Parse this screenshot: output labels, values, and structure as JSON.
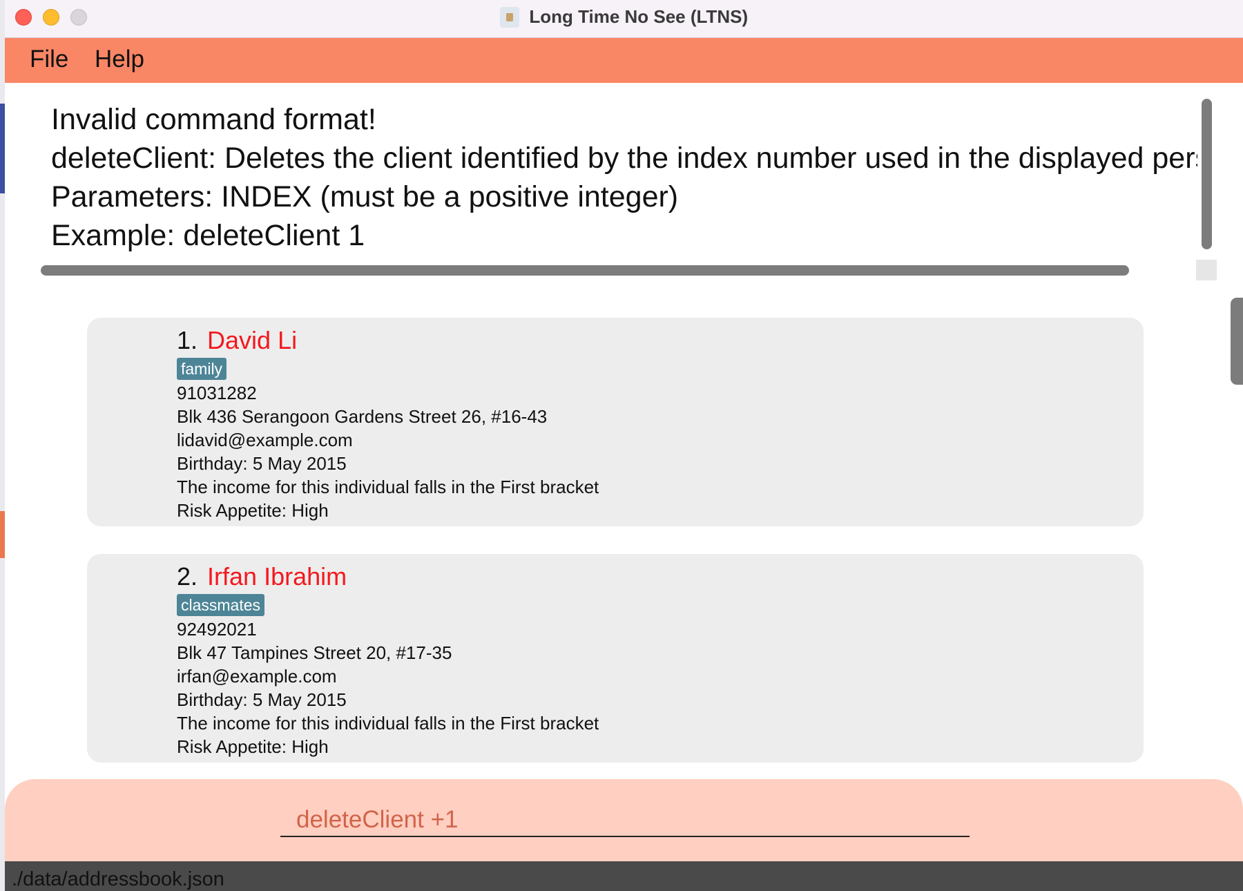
{
  "window": {
    "title": "Long Time No See (LTNS)",
    "icon": "ltns-app-icon"
  },
  "menu": {
    "items": [
      {
        "label": "File"
      },
      {
        "label": "Help"
      }
    ]
  },
  "result": {
    "lines": [
      "Invalid command format!",
      "deleteClient: Deletes the client identified by the index number used in the displayed person",
      "Parameters: INDEX (must be a positive integer)",
      "Example: deleteClient 1"
    ]
  },
  "clients": [
    {
      "index": "1.",
      "name": "David Li",
      "tag": "family",
      "phone": "91031282",
      "address": "Blk 436 Serangoon Gardens Street 26, #16-43",
      "email": "lidavid@example.com",
      "birthday": "Birthday: 5 May 2015",
      "income": "The income for this individual falls in the First bracket",
      "risk": "Risk Appetite: High"
    },
    {
      "index": "2.",
      "name": "Irfan Ibrahim",
      "tag": "classmates",
      "phone": "92492021",
      "address": "Blk 47 Tampines Street 20, #17-35",
      "email": "irfan@example.com",
      "birthday": "Birthday: 5 May 2015",
      "income": "The income for this individual falls in the First bracket",
      "risk": "Risk Appetite: High"
    }
  ],
  "command": {
    "value": "deleteClient +1"
  },
  "status": {
    "file_path": "./data/addressbook.json"
  },
  "colors": {
    "menu_bar": "#f98665",
    "command_area": "#ffcfc1",
    "command_text": "#d1644b",
    "client_name": "#f4181e",
    "tag_background": "#4d8597",
    "card_background": "#ededed",
    "status_bar": "#4a4a4a"
  }
}
